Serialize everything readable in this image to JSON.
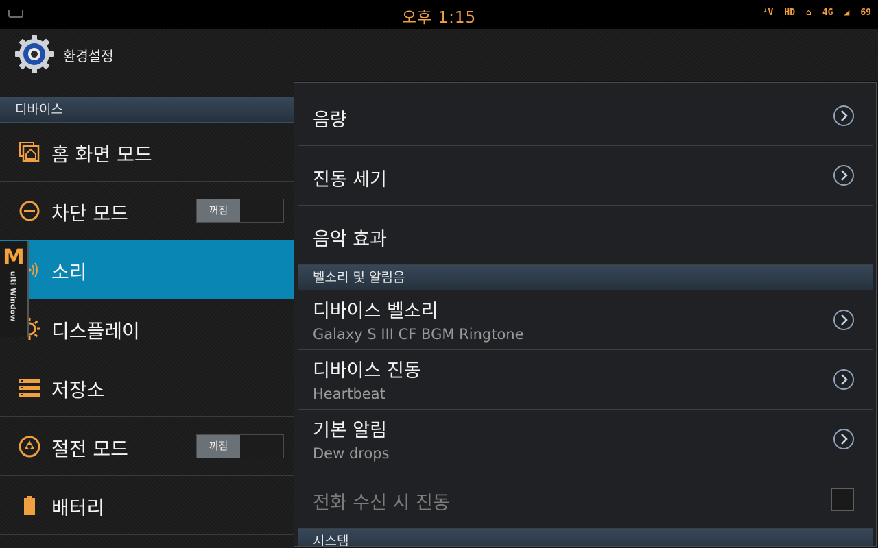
{
  "status_bar": {
    "time": "오후 1:15",
    "icons": [
      "ꜜV",
      "HD",
      "A",
      "4G",
      "signal",
      "69"
    ]
  },
  "action_bar": {
    "title": "환경설정",
    "icon": "gear-icon"
  },
  "sidebar": {
    "section": "디바이스",
    "items": [
      {
        "label": "홈 화면 모드",
        "icon": "home-icon"
      },
      {
        "label": "차단 모드",
        "icon": "block-icon",
        "toggle": "꺼짐"
      },
      {
        "label": "소리",
        "icon": "sound-icon",
        "active": true
      },
      {
        "label": "디스플레이",
        "icon": "brightness-icon"
      },
      {
        "label": "저장소",
        "icon": "storage-icon"
      },
      {
        "label": "절전 모드",
        "icon": "power-saving-icon",
        "toggle": "꺼짐"
      },
      {
        "label": "배터리",
        "icon": "battery-icon"
      }
    ]
  },
  "multi_window": {
    "letter": "M",
    "text": "ulti Window"
  },
  "detail": {
    "items": [
      {
        "title": "음량"
      },
      {
        "title": "진동 세기"
      },
      {
        "title": "음악 효과"
      }
    ],
    "ringtones_header": "벨소리 및 알림음",
    "ringtones": [
      {
        "title": "디바이스 벨소리",
        "summary": "Galaxy S III CF BGM Ringtone"
      },
      {
        "title": "디바이스 진동",
        "summary": "Heartbeat"
      },
      {
        "title": "기본 알림",
        "summary": "Dew drops"
      }
    ],
    "vibrate_on_ring": "전화 수신 시 진동",
    "system_header": "시스템"
  },
  "colors": {
    "accent_orange": "#f0a040",
    "active_blue": "#0a86b5",
    "section_header": "#2d3b4a"
  }
}
